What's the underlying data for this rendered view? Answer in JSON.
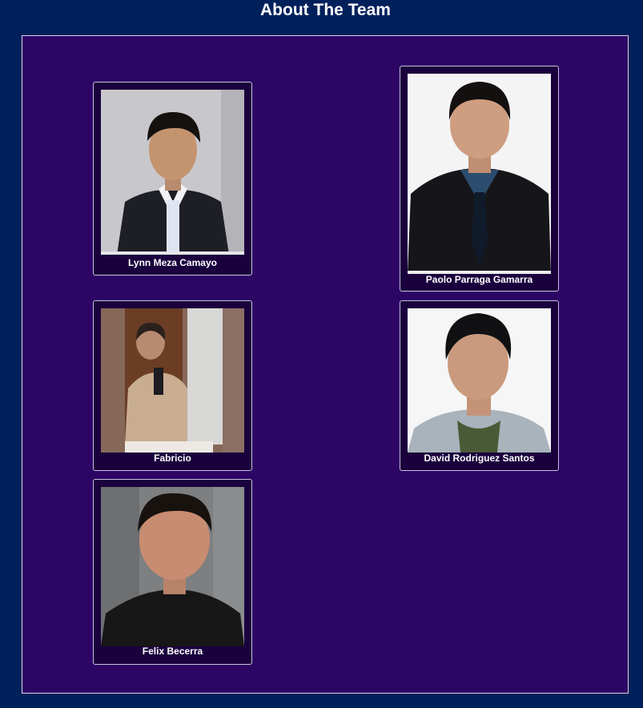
{
  "page": {
    "title": "About The Team"
  },
  "members": [
    {
      "name": "Lynn Meza Camayo",
      "photo": "portrait-photo"
    },
    {
      "name": "Paolo Parraga Gamarra",
      "photo": "portrait-photo"
    },
    {
      "name": "Fabricio",
      "photo": "portrait-photo"
    },
    {
      "name": "David Rodriguez Santos",
      "photo": "portrait-photo"
    },
    {
      "name": "Felix Becerra",
      "photo": "portrait-photo"
    }
  ],
  "colors": {
    "page_background": "#00205b",
    "panel_background": "#2c0565",
    "card_background": "#1a003d",
    "text": "#ffffff"
  }
}
